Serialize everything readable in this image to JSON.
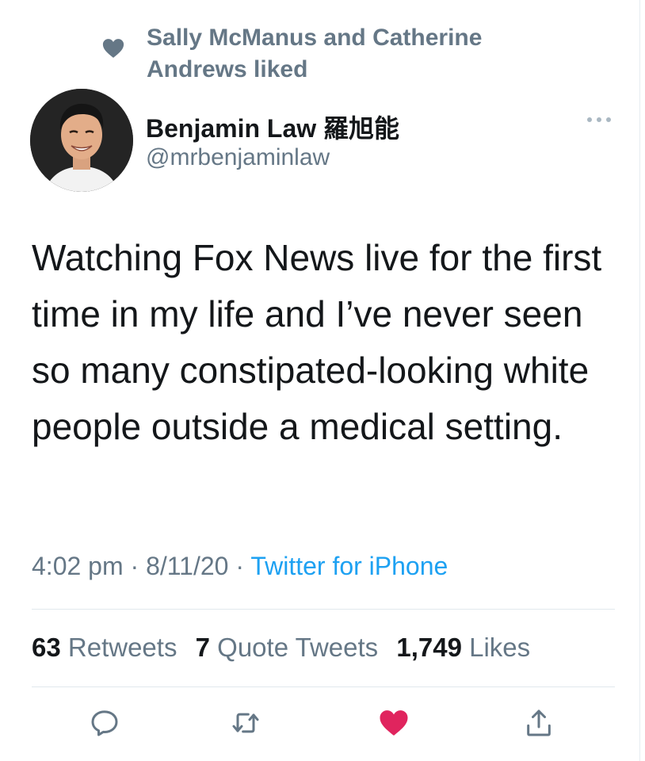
{
  "social_context": {
    "text": "Sally McManus and Catherine Andrews liked",
    "icon": "heart-icon"
  },
  "author": {
    "name": "Benjamin Law 羅旭能",
    "handle": "@mrbenjaminlaw"
  },
  "tweet": {
    "text": "Watching Fox News live for the first time in my life and I’ve never seen so many constipated-looking white people outside a medical setting.",
    "time": "4:02 pm",
    "date": "8/11/20",
    "separator": "·",
    "source": "Twitter for iPhone"
  },
  "stats": {
    "retweets_count": "63",
    "retweets_label": "Retweets",
    "quotes_count": "7",
    "quotes_label": "Quote Tweets",
    "likes_count": "1,749",
    "likes_label": "Likes"
  },
  "actions": {
    "reply_icon": "reply-icon",
    "retweet_icon": "retweet-icon",
    "like_icon": "heart-icon",
    "share_icon": "share-icon",
    "liked": true
  },
  "colors": {
    "accent": "#1da1f2",
    "secondary_text": "#657786",
    "like": "#e0245e",
    "icon_gray": "#657786"
  }
}
